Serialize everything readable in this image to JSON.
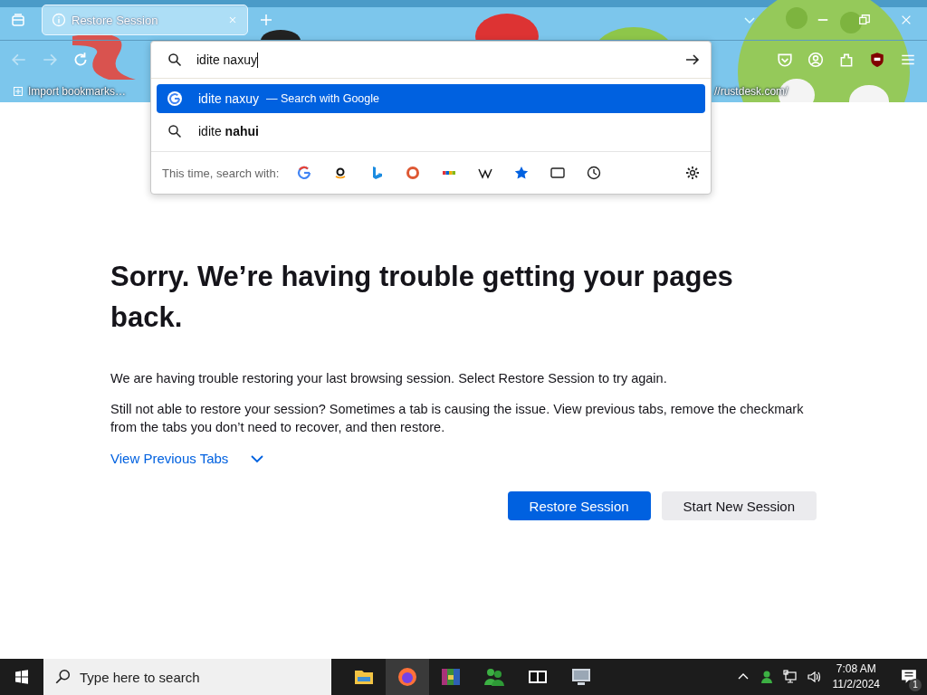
{
  "tab_strip": {
    "tabs": [
      {
        "title": "Restore Session",
        "selected": true
      }
    ]
  },
  "bookmarks": [
    {
      "label": "Import bookmarks…"
    },
    {
      "label": "//rustdesk.com/"
    }
  ],
  "url_dropdown": {
    "value": "idite naxuy",
    "results": [
      {
        "kind": "engine",
        "text": "idite naxuy",
        "action": "— Search with Google",
        "selected": true
      },
      {
        "kind": "suggestion",
        "text": "idite **nahui**",
        "selected": false
      }
    ],
    "search_with_label": "This time, search with:"
  },
  "page": {
    "title": "Sorry. We’re having trouble getting your pages back.",
    "paragraphs": [
      "We are having trouble restoring your last browsing session. Select Restore Session to try again.",
      "Still not able to restore your session? Sometimes a tab is causing the issue. View previous tabs, remove the checkmark from the tabs you don’t need to recover, and then restore."
    ],
    "view_tabs_link": "View Previous Tabs",
    "buttons": [
      {
        "label": "Restore Session",
        "primary": true
      },
      {
        "label": "Start New Session",
        "primary": false
      }
    ]
  },
  "taskbar": {
    "search_placeholder": "Type here to search",
    "time": "7:08 AM",
    "date": "11/2/2024",
    "notification_count": "1"
  }
}
